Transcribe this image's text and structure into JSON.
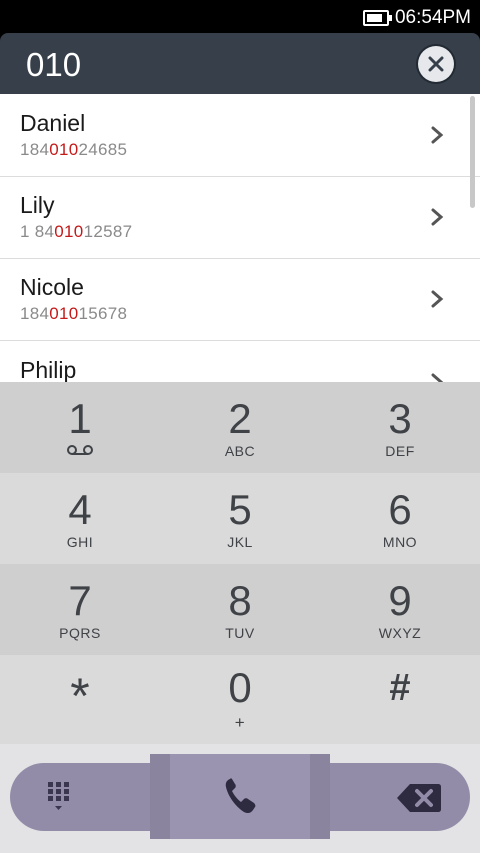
{
  "status": {
    "time": "06:54PM",
    "battery_level": 0.85
  },
  "search": {
    "query": "010"
  },
  "contacts": [
    {
      "name": "Daniel",
      "pre": "184",
      "match": "010",
      "post": "24685"
    },
    {
      "name": "Lily",
      "pre": "1 84",
      "match": "010",
      "post": "12587"
    },
    {
      "name": "Nicole",
      "pre": "184",
      "match": "010",
      "post": "15678"
    },
    {
      "name": "Philip",
      "pre": "",
      "match": "",
      "post": ""
    }
  ],
  "keys": [
    {
      "digit": "1",
      "letters": ""
    },
    {
      "digit": "2",
      "letters": "ABC"
    },
    {
      "digit": "3",
      "letters": "DEF"
    },
    {
      "digit": "4",
      "letters": "GHI"
    },
    {
      "digit": "5",
      "letters": "JKL"
    },
    {
      "digit": "6",
      "letters": "MNO"
    },
    {
      "digit": "7",
      "letters": "PQRS"
    },
    {
      "digit": "8",
      "letters": "TUV"
    },
    {
      "digit": "9",
      "letters": "WXYZ"
    },
    {
      "digit": "*",
      "letters": ""
    },
    {
      "digit": "0",
      "letters": "+"
    },
    {
      "digit": "#",
      "letters": ""
    }
  ],
  "colors": {
    "header": "#363f4a",
    "highlight": "#c41a1a",
    "keypad_dark": "#cfcfcf",
    "keypad_light": "#dadada",
    "action_bar": "#928ca8"
  },
  "icons": {
    "voicemail": "voicemail-icon",
    "clear": "close-icon",
    "chevron": "chevron-right-icon",
    "dialpad": "dialpad-grid-icon",
    "call": "phone-icon",
    "backspace": "backspace-icon"
  }
}
